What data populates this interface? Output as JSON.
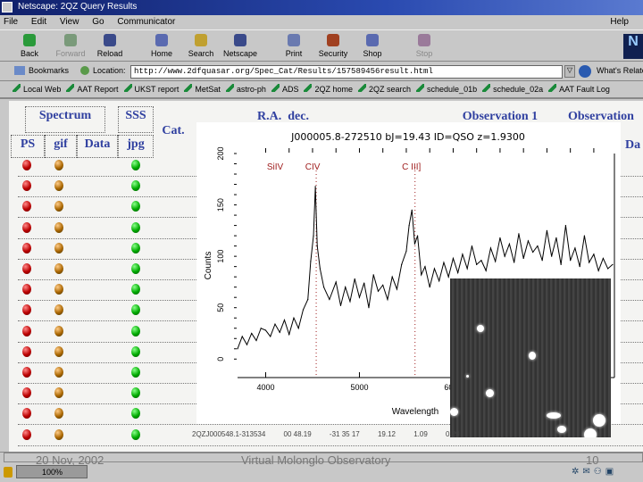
{
  "window": {
    "title": "Netscape: 2QZ Query Results"
  },
  "menu": [
    "File",
    "Edit",
    "View",
    "Go",
    "Communicator"
  ],
  "menu_right": "Help",
  "toolbar": [
    {
      "label": "Back",
      "icon": "back-icon"
    },
    {
      "label": "Forward",
      "icon": "forward-icon",
      "disabled": true
    },
    {
      "label": "Reload",
      "icon": "reload-icon"
    },
    {
      "label": "Home",
      "icon": "home-icon"
    },
    {
      "label": "Search",
      "icon": "search-icon"
    },
    {
      "label": "Netscape",
      "icon": "netscape-icon"
    },
    {
      "label": "Print",
      "icon": "print-icon"
    },
    {
      "label": "Security",
      "icon": "security-icon"
    },
    {
      "label": "Shop",
      "icon": "shop-icon"
    },
    {
      "label": "Stop",
      "icon": "stop-icon",
      "disabled": true
    }
  ],
  "location": {
    "bookmarks": "Bookmarks",
    "label": "Location:",
    "url": "http://www.2dfquasar.org/Spec_Cat/Results/157589456result.html",
    "related": "What's Related"
  },
  "personal": [
    "Local Web",
    "AAT Report",
    "UKST report",
    "MetSat",
    "astro-ph",
    "ADS",
    "2QZ home",
    "2QZ search",
    "schedule_01b",
    "schedule_02a",
    "AAT Fault Log"
  ],
  "table": {
    "headers": {
      "spectrum": "Spectrum",
      "sss": "SSS",
      "cat": "Cat.",
      "ps": "PS",
      "gif": "gif",
      "data": "Data",
      "jpg": "jpg",
      "ra": "R.A.",
      "dec": "dec.",
      "obs1": "Observation 1",
      "obs2": "Observation",
      "data2": "Da"
    },
    "row_count": 14,
    "last_row": [
      "2QZJ000548.1-313534",
      "00 48.19",
      "-31 35 17",
      "19.12",
      "1.09",
      "0.29"
    ]
  },
  "chart_data": {
    "type": "line",
    "title": "J000005.8-272510   bJ=19.43   ID=QSO        z=1.9300",
    "xlabel": "Wavelength",
    "ylabel": "Counts",
    "xlim": [
      3700,
      7720
    ],
    "ylim": [
      -18,
      200
    ],
    "xticks": [
      4000,
      5000,
      6000
    ],
    "xtick_labels": [
      "4000",
      "5000",
      "6000"
    ],
    "yticks": [
      0,
      50,
      100,
      150,
      200
    ],
    "lines": [
      {
        "label": "SiIV",
        "x": 4100,
        "show_line": false
      },
      {
        "label": "CIV",
        "x": 4539,
        "show_line": true
      },
      {
        "label": "C III]",
        "x": 5593,
        "show_line": true
      }
    ],
    "x": [
      3700,
      3750,
      3800,
      3850,
      3900,
      3950,
      4000,
      4050,
      4100,
      4150,
      4200,
      4250,
      4300,
      4350,
      4400,
      4450,
      4480,
      4510,
      4530,
      4550,
      4580,
      4620,
      4680,
      4750,
      4800,
      4850,
      4900,
      4950,
      5000,
      5050,
      5100,
      5150,
      5200,
      5250,
      5300,
      5350,
      5400,
      5450,
      5500,
      5530,
      5560,
      5590,
      5620,
      5660,
      5700,
      5750,
      5800,
      5850,
      5900,
      5950,
      6000,
      6050,
      6100,
      6150,
      6200,
      6250,
      6300,
      6350,
      6400,
      6450,
      6500,
      6550,
      6600,
      6650,
      6700,
      6750,
      6800,
      6850,
      6900,
      6950,
      7000,
      7050,
      7100,
      7150,
      7200,
      7250,
      7300,
      7350,
      7400,
      7450,
      7500,
      7550,
      7600,
      7650,
      7700
    ],
    "y": [
      10,
      22,
      14,
      25,
      18,
      30,
      28,
      22,
      34,
      26,
      38,
      24,
      40,
      30,
      48,
      58,
      95,
      120,
      168,
      110,
      88,
      70,
      58,
      75,
      52,
      70,
      56,
      78,
      60,
      74,
      50,
      82,
      66,
      72,
      58,
      80,
      68,
      92,
      105,
      130,
      145,
      112,
      120,
      82,
      90,
      70,
      88,
      76,
      94,
      80,
      98,
      84,
      102,
      88,
      110,
      92,
      96,
      86,
      108,
      95,
      118,
      100,
      112,
      94,
      122,
      98,
      115,
      104,
      110,
      96,
      125,
      100,
      118,
      92,
      130,
      96,
      108,
      90,
      120,
      94,
      102,
      86,
      98,
      88,
      92
    ]
  },
  "footer": {
    "date": "20 Nov, 2002",
    "title": "Virtual Molonglo Observatory",
    "page": "10"
  },
  "status": {
    "progress": "100%"
  }
}
